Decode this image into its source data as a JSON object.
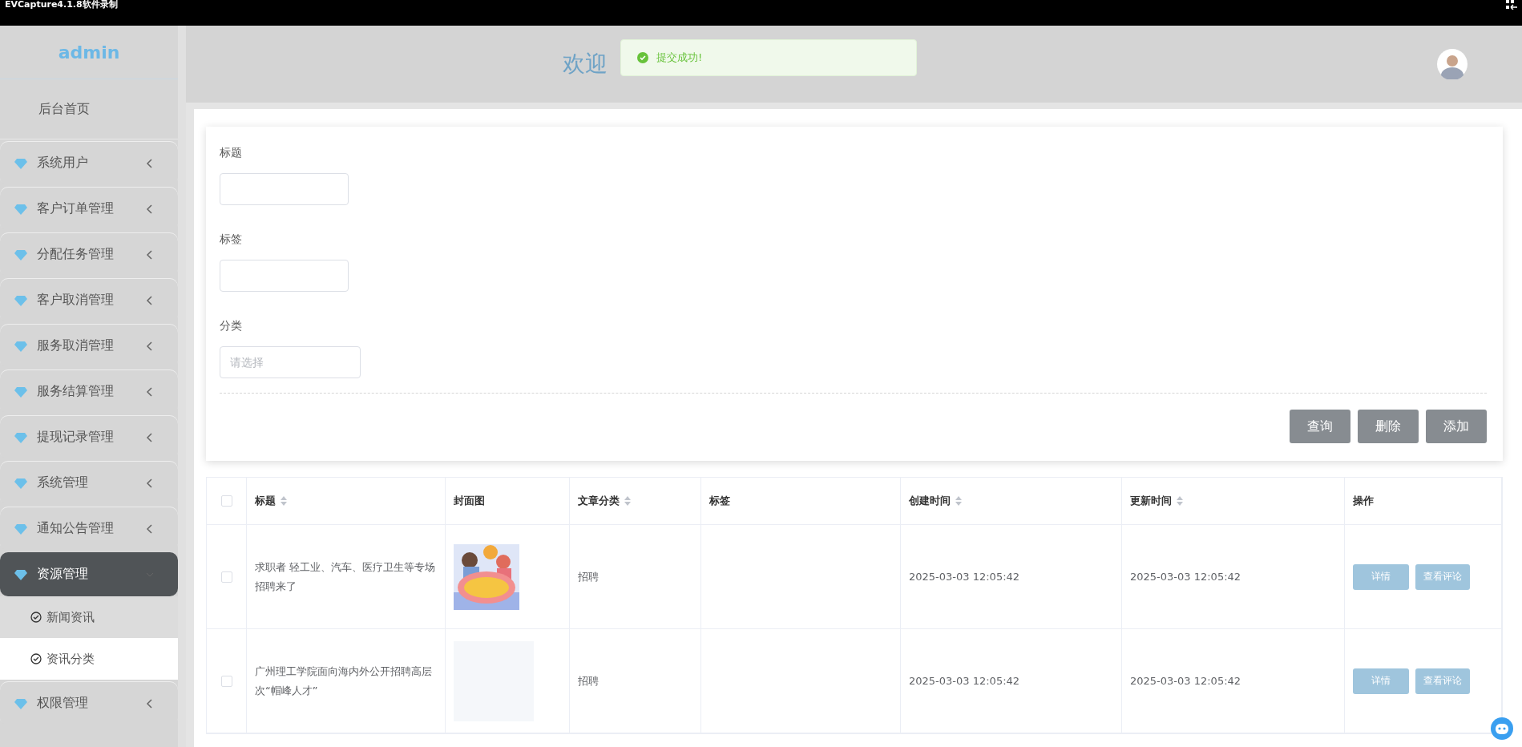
{
  "recorder_bar": {
    "title": "EVCapture4.1.8软件录制"
  },
  "sidebar": {
    "brand": "admin",
    "home": "后台首页",
    "items": [
      {
        "label": "系统用户",
        "expanded": false
      },
      {
        "label": "客户订单管理",
        "expanded": false
      },
      {
        "label": "分配任务管理",
        "expanded": false
      },
      {
        "label": "客户取消管理",
        "expanded": false
      },
      {
        "label": "服务取消管理",
        "expanded": false
      },
      {
        "label": "服务结算管理",
        "expanded": false
      },
      {
        "label": "提现记录管理",
        "expanded": false
      },
      {
        "label": "系统管理",
        "expanded": false
      },
      {
        "label": "通知公告管理",
        "expanded": false
      },
      {
        "label": "资源管理",
        "expanded": true,
        "children": [
          {
            "label": "新闻资讯",
            "selected": false
          },
          {
            "label": "资讯分类",
            "selected": true
          }
        ]
      },
      {
        "label": "权限管理",
        "expanded": false
      }
    ]
  },
  "header": {
    "title": "欢迎"
  },
  "toast": {
    "message": "提交成功!"
  },
  "search_form": {
    "fields": [
      {
        "label": "标题",
        "kind": "text"
      },
      {
        "label": "标签",
        "kind": "text"
      },
      {
        "label": "分类",
        "kind": "select",
        "placeholder": "请选择"
      }
    ],
    "buttons": [
      "查询",
      "删除",
      "添加"
    ]
  },
  "table": {
    "all_checked": false,
    "columns": [
      {
        "label": "标题",
        "sortable": true
      },
      {
        "label": "封面图",
        "sortable": false
      },
      {
        "label": "文章分类",
        "sortable": true
      },
      {
        "label": "标签",
        "sortable": false
      },
      {
        "label": "创建时间",
        "sortable": true
      },
      {
        "label": "更新时间",
        "sortable": true
      },
      {
        "label": "操作",
        "sortable": false
      }
    ],
    "rows": [
      {
        "checked": false,
        "title": "求职者 轻工业、汽车、医疗卫生等专场招聘来了",
        "cover": {
          "kind": "picture"
        },
        "category": "招聘",
        "created": "2025-03-03 12:05:42",
        "updated": "2025-03-03 12:05:42",
        "actions": [
          "详情",
          "查看评论"
        ]
      },
      {
        "checked": false,
        "title": "广州理工学院面向海内外公开招聘高层次“帽峰人才”",
        "category": "招聘",
        "created": "2025-03-03 12:05:42",
        "updated": "2025-03-03 12:05:42",
        "actions": [
          "详情",
          "查看评论"
        ]
      }
    ]
  }
}
